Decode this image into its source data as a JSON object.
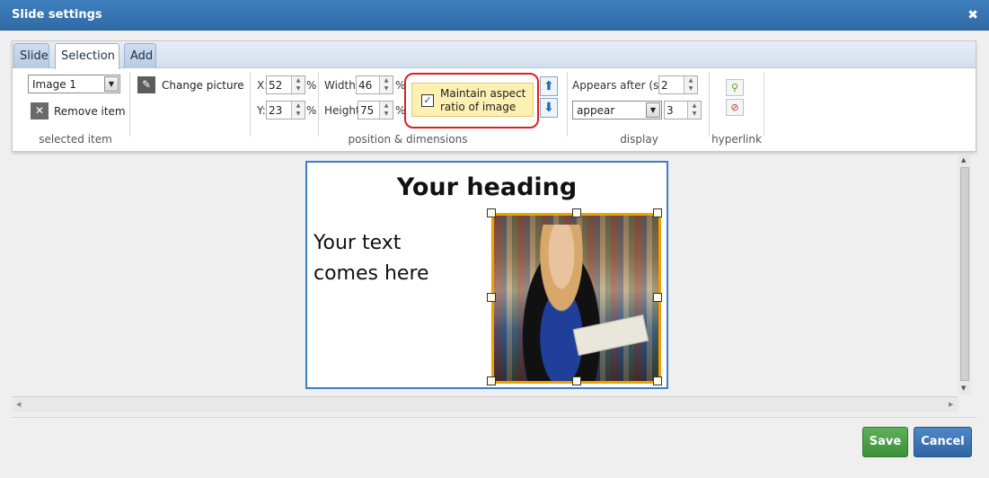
{
  "window": {
    "title": "Slide settings",
    "close_glyph": "✖"
  },
  "tabs": [
    {
      "label": "Slide"
    },
    {
      "label": "Selection",
      "active": true
    },
    {
      "label": "Add"
    }
  ],
  "selected_item": {
    "select_value": "Image 1",
    "remove_label": "Remove item",
    "group_label": "selected item"
  },
  "change_picture": {
    "label": "Change picture"
  },
  "position": {
    "x_label": "X:",
    "x_value": "52",
    "x_unit": "%",
    "y_label": "Y:",
    "y_value": "23",
    "y_unit": "%",
    "width_label": "Width",
    "width_value": "46",
    "width_unit": "%",
    "height_label": "Height",
    "height_value": "75",
    "height_unit": "%",
    "aspect_line1": "Maintain aspect",
    "aspect_line2": "ratio of image",
    "aspect_checked": true,
    "group_label": "position & dimensions"
  },
  "display": {
    "appears_label": "Appears after (s):",
    "appears_value": "2",
    "effect_value": "appear",
    "duration_value": "3",
    "group_label": "display"
  },
  "hyperlink": {
    "group_label": "hyperlink"
  },
  "slide": {
    "heading": "Your heading",
    "body_line1": "Your text",
    "body_line2": "comes here"
  },
  "footer": {
    "save_label": "Save",
    "cancel_label": "Cancel"
  },
  "colors": {
    "title_bar": "#2f6aa6",
    "highlight": "#e02020",
    "image_border": "#f2a000"
  }
}
